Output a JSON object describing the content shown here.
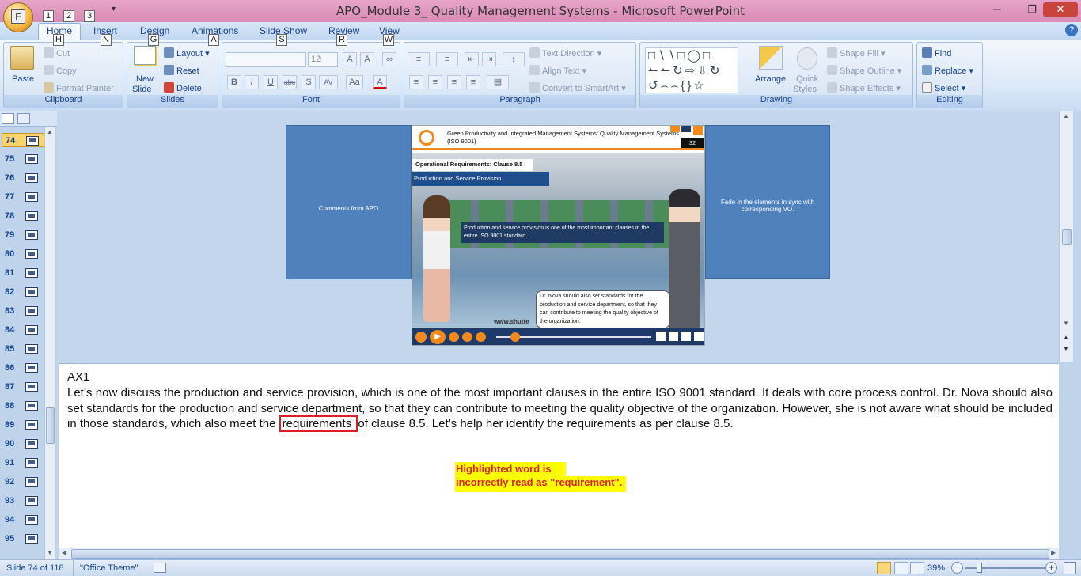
{
  "window": {
    "title": "APO_Module 3_ Quality Management Systems - Microsoft PowerPoint",
    "office_button_key": "F",
    "qat_keys": [
      "1",
      "2",
      "3"
    ],
    "controls": [
      "minimize-icon",
      "restore-icon",
      "close-icon"
    ]
  },
  "tabs": [
    {
      "label": "Home",
      "key": "H"
    },
    {
      "label": "Insert",
      "key": "N"
    },
    {
      "label": "Design",
      "key": "G"
    },
    {
      "label": "Animations",
      "key": "A"
    },
    {
      "label": "Slide Show",
      "key": "S"
    },
    {
      "label": "Review",
      "key": "R"
    },
    {
      "label": "View",
      "key": "W"
    }
  ],
  "ribbon": {
    "clipboard": {
      "label": "Clipboard",
      "paste": "Paste",
      "cut": "Cut",
      "copy": "Copy",
      "format_painter": "Format Painter"
    },
    "slides": {
      "label": "Slides",
      "new_slide_1": "New",
      "new_slide_2": "Slide",
      "layout": "Layout",
      "reset": "Reset",
      "delete": "Delete"
    },
    "font": {
      "label": "Font",
      "size": "12"
    },
    "paragraph": {
      "label": "Paragraph",
      "text_direction": "Text Direction",
      "align_text": "Align Text",
      "convert_smartart": "Convert to SmartArt"
    },
    "drawing": {
      "label": "Drawing",
      "arrange": "Arrange",
      "quick_styles_1": "Quick",
      "quick_styles_2": "Styles",
      "shape_fill": "Shape Fill",
      "shape_outline": "Shape Outline",
      "shape_effects": "Shape Effects"
    },
    "editing": {
      "label": "Editing",
      "find": "Find",
      "replace": "Replace",
      "select": "Select"
    }
  },
  "slide_list": {
    "numbers": [
      "74",
      "75",
      "76",
      "77",
      "78",
      "79",
      "80",
      "81",
      "82",
      "83",
      "84",
      "85",
      "86",
      "87",
      "88",
      "89",
      "90",
      "91",
      "92",
      "93",
      "94",
      "95"
    ],
    "selected": "74"
  },
  "slide": {
    "left_comment": "Comments from APO",
    "right_comment": "Fade in the elements in sync with corresponding VO.",
    "header_title": "Green Productivity and Integrated Management Systems: Quality Management Systems (ISO 9001)",
    "page_number": "32",
    "section_title": "Operational Requirements: Clause 8.5",
    "subsection": "Production and Service Provision",
    "callout_1": "Production and service provision is one of the most important clauses in the entire ISO 9001 standard.",
    "callout_2": "Dr. Nova should also set standards for the production and service department, so that they can contribute to meeting the quality objective of the organization.",
    "watermark": "www.shutte"
  },
  "notes": {
    "tag": "AX1",
    "text_before": "Let’s now discuss  the production and service provision, which is one of the most important clauses  in the entire ISO 9001 standard. It deals with core process control. Dr. Nova should also set standards for the production and service department, so that they can contribute to meeting  the quality objective of the organization. However, she is not aware what should be included in those standards, which also meet  the",
    "highlighted_word": "requirements ",
    "text_after": " of clause  8.5. Let’s help her identify the requirements  as per clause  8.5.",
    "annotation_line1": "Highlighted word is",
    "annotation_line2": "incorrectly read as \"requirement\"."
  },
  "status": {
    "slide_info": "Slide 74 of 118",
    "theme": "\"Office Theme\"",
    "zoom": "39%"
  },
  "colors": {
    "accent": "#4f81bd",
    "highlight": "#ffff00",
    "alert": "#e01c24"
  }
}
